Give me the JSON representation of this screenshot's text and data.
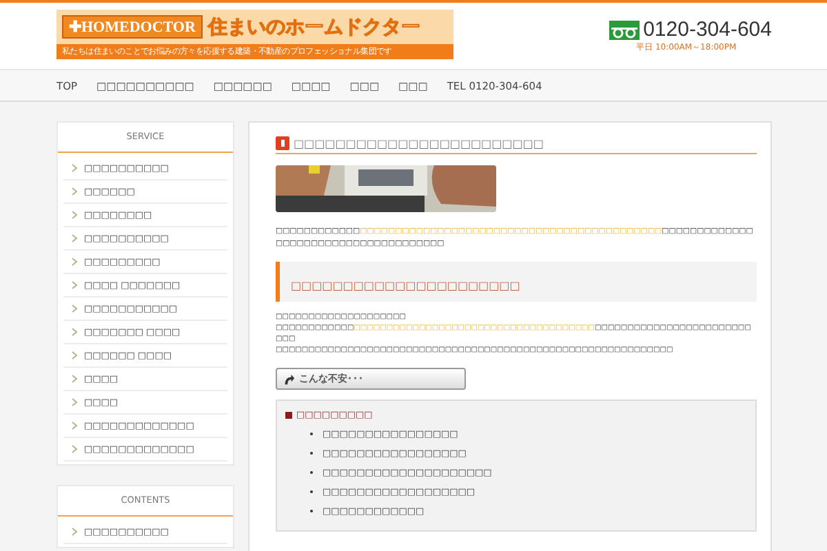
{
  "header": {
    "logo_badge": "✚HOMEDOCTOR",
    "logo_title": "住まいのホームドクター",
    "tagline": "私たちは住まいのことでお悩みの方々を応援する建築・不動産のプロフェッショナル集団です",
    "phone": "0120-304-604",
    "hours": "平日 10:00AM～18:00PM"
  },
  "nav": [
    {
      "label": "TOP"
    },
    {
      "label": "□□□□□□□□□□"
    },
    {
      "label": "□□□□□□"
    },
    {
      "label": "□□□□"
    },
    {
      "label": "□□□"
    },
    {
      "label": "□□□"
    },
    {
      "label": "TEL 0120-304-604"
    }
  ],
  "sidebar": [
    {
      "title": "SERVICE",
      "items": [
        "□□□□□□□□□□",
        "□□□□□□",
        "□□□□□□□□",
        "□□□□□□□□□□",
        "□□□□□□□□□",
        "□□□□ □□□□□□□",
        "□□□□□□□□□□□",
        "□□□□□□□ □□□□",
        "□□□□□□ □□□□",
        "□□□□",
        "□□□□",
        "□□□□□□□□□□□□□",
        "□□□□□□□□□□□□□"
      ]
    },
    {
      "title": "CONTENTS",
      "items": [
        "□□□□□□□□□□"
      ]
    }
  ],
  "main": {
    "title": "□□□□□□□□□□□□□□□□□□□□□□□□",
    "intro": [
      {
        "text": "□□□□□□□□□□□□",
        "highlight": false
      },
      {
        "text": "□□□□□□□□□□□□□□□□□□□□□□□□□□□□□□□□□□□□□□□□□□□",
        "highlight": true
      },
      {
        "text": "□□□□□□□□□□□□□□□□□□□□□□□□□□□□□□□□□□□□□",
        "highlight": false
      }
    ],
    "section_title": "□□□□□□□□□□□□□□□□□□□□□□",
    "body": [
      [
        {
          "text": "□□□□□□□□□□□□□□□□□□□□",
          "highlight": false
        }
      ],
      [
        {
          "text": "□□□□□□□□□□□□",
          "highlight": false
        },
        {
          "text": "□□□□□□□□□□□□□□□□□□□□□□□□□□□□□□□□□□□□□",
          "highlight": true
        },
        {
          "text": "□□□□□□□□□□□□□□□□□□□□□□□□□□□",
          "highlight": false
        }
      ],
      [
        {
          "text": "□□□□□□□□□□□□□□□□□□□□□□□□□□□□□□□□□□□□□□□□□□□□□□□□□□□□□□□□□□□□□",
          "highlight": false
        }
      ]
    ],
    "callout": "こんな不安･･･",
    "box": {
      "title": "□□□□□□□□□",
      "items": [
        "□□□□□□□□□□□□□□□□",
        "□□□□□□□□□□□□□□□□□",
        "□□□□□□□□□□□□□□□□□□□□",
        "□□□□□□□□□□□□□□□□□□",
        "□□□□□□□□□□□□"
      ]
    }
  }
}
